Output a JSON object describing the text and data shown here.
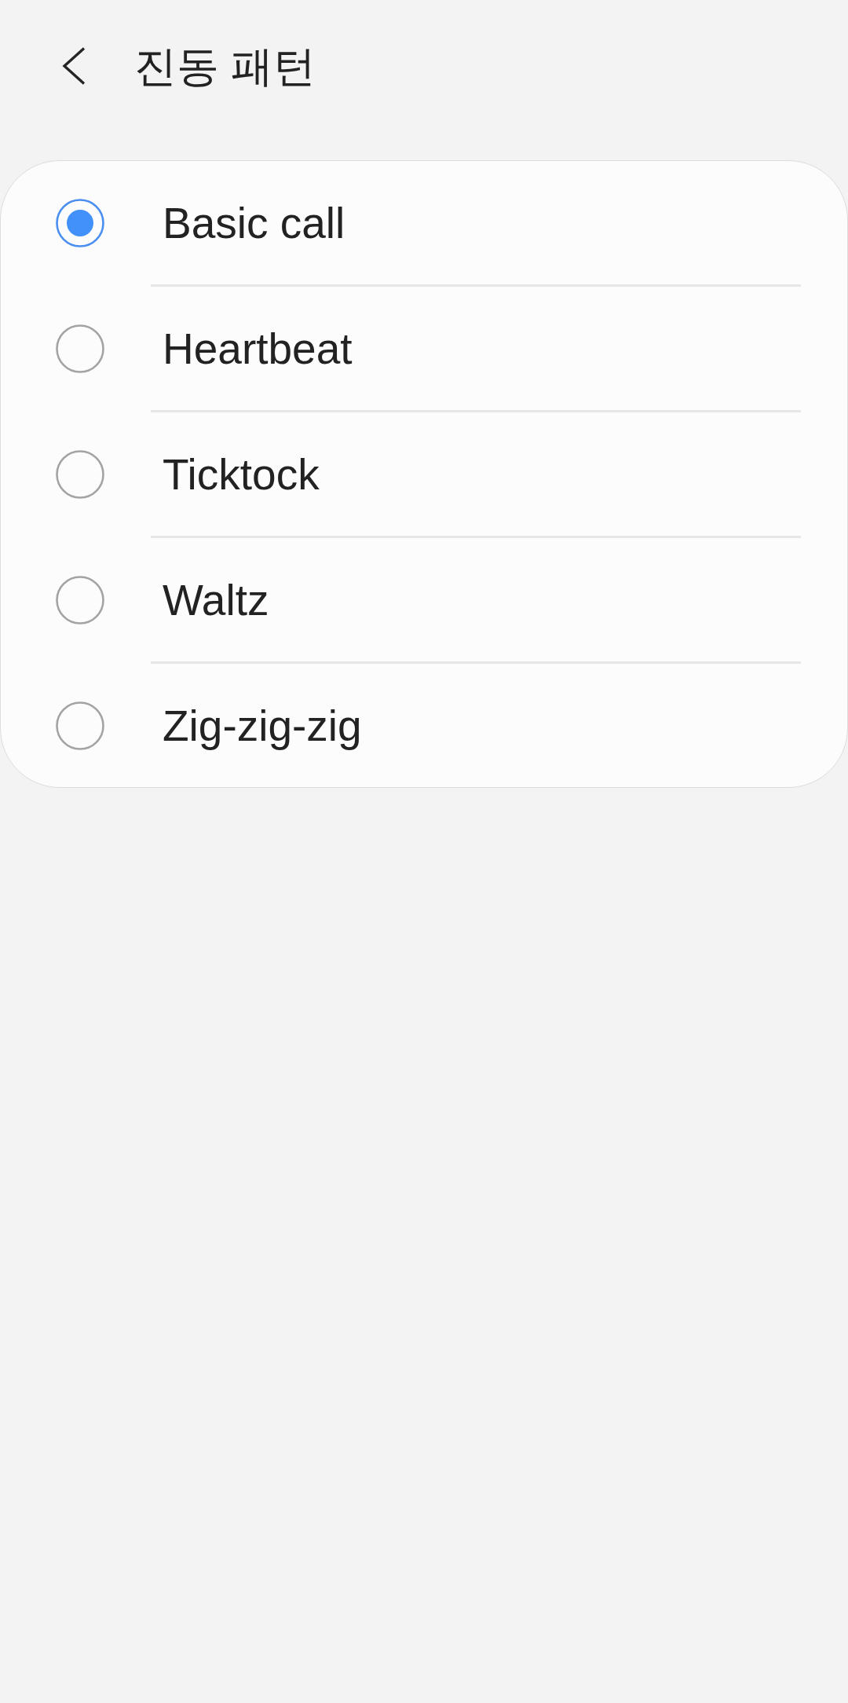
{
  "header": {
    "title": "진동 패턴"
  },
  "patterns": [
    {
      "label": "Basic call",
      "selected": true
    },
    {
      "label": "Heartbeat",
      "selected": false
    },
    {
      "label": "Ticktock",
      "selected": false
    },
    {
      "label": "Waltz",
      "selected": false
    },
    {
      "label": "Zig-zig-zig",
      "selected": false
    }
  ]
}
